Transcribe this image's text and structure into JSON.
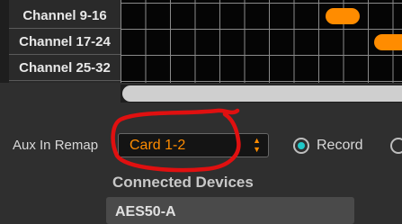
{
  "matrix": {
    "rows": [
      {
        "label": "Channel 9-16"
      },
      {
        "label": "Channel 17-24"
      },
      {
        "label": "Channel 25-32"
      }
    ]
  },
  "remap": {
    "label": "Aux In Remap",
    "selected": "Card 1-2"
  },
  "radio": {
    "record_label": "Record",
    "record_selected": true
  },
  "connected_devices": {
    "title": "Connected Devices",
    "items": [
      "AES50-A"
    ]
  },
  "colors": {
    "accent": "#ff8c00",
    "radio": "#20c8c8",
    "annotation": "#e01010"
  }
}
